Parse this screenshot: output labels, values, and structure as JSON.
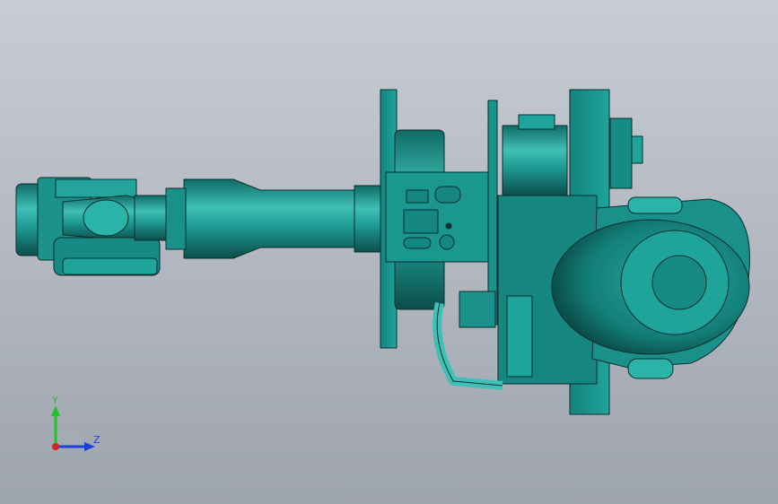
{
  "viewport": {
    "background_top": "#c9ccd2",
    "background_bottom": "#9ea4ae",
    "model_color": "#1f9a94",
    "model_dark": "#0f5f5b",
    "model_edge": "#0a2f2d"
  },
  "triad": {
    "y_label": "Y",
    "z_label": "Z",
    "y_color": "#22c22e",
    "z_color": "#1f3fd6",
    "origin_color": "#d0261f"
  }
}
